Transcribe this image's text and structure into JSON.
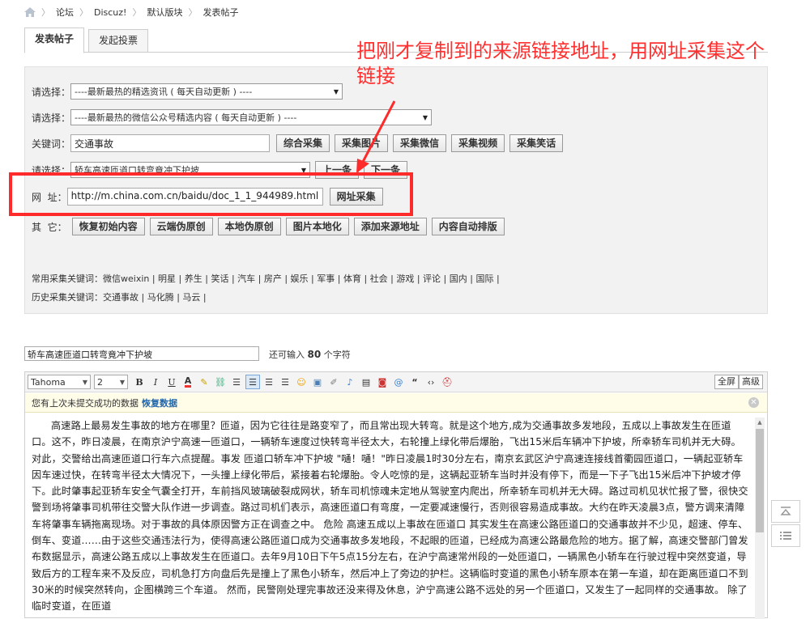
{
  "breadcrumb": [
    "论坛",
    "Discuz!",
    "默认版块",
    "发表帖子"
  ],
  "tabs": [
    "发表帖子",
    "发起投票"
  ],
  "panel": {
    "select1_label": "请选择：",
    "select1_value": "----最新最热的精选资讯 ( 每天自动更新 ) ----",
    "select2_label": "请选择：",
    "select2_value": "----最新最热的微信公众号精选内容 ( 每天自动更新 ) ----",
    "keyword_label": "关键词：",
    "keyword_value": "交通事故",
    "keyword_buttons": [
      "综合采集",
      "采集图片",
      "采集微信",
      "采集视频",
      "采集笑话"
    ],
    "select3_label": "请选择：",
    "select3_value": "轿车高速匝道口转弯竟冲下护坡",
    "prev_button": "上一条",
    "next_button": "下一条",
    "url_label": "网  址：",
    "url_value": "http://m.china.com.cn/baidu/doc_1_1_944989.html",
    "url_button": "网址采集",
    "other_label": "其  它：",
    "other_buttons": [
      "恢复初始内容",
      "云端伪原创",
      "本地伪原创",
      "图片本地化",
      "添加来源地址",
      "内容自动排版"
    ],
    "common_keywords": "常用采集关键词：微信weixin | 明星 | 养生 | 笑话 | 汽车 | 房产 | 娱乐 | 军事 | 体育 | 社会 | 游戏 | 评论 | 国内 | 国际 |",
    "history_keywords": "历史采集关键词：交通事故 | 马化腾 | 马云 |"
  },
  "annotation": {
    "text": "把刚才复制到的来源链接地址，用网址采集这个链接",
    "color": "#ff3030"
  },
  "post": {
    "title_value": "轿车高速匝道口转弯竟冲下护坡",
    "remaining_prefix": "还可输入",
    "remaining_count": "80",
    "remaining_suffix": "个字符"
  },
  "editor": {
    "font_family": "Tahoma",
    "font_size": "2",
    "toolbar_icons": [
      "bold-icon",
      "italic-icon",
      "underline-icon",
      "font-color-icon",
      "background-color-icon",
      "link-icon",
      "align-left-icon",
      "align-center-icon",
      "align-right-icon",
      "align-justify-icon",
      "emoticon-icon",
      "image-icon",
      "attachment-icon",
      "music-icon",
      "video-icon",
      "flash-icon",
      "mention-icon",
      "quote-icon",
      "code-icon",
      "free-icon"
    ],
    "fullscreen_label": "全屏",
    "advanced_label": "高级",
    "notice_text": "您有上次未提交成功的数据",
    "restore_label": "恢复数据",
    "article": "高速路上最易发生事故的地方在哪里？匝道，因为它往往是路变窄了，而且常出现大转弯。就是这个地方,成为交通事故多发地段，五成以上事故发生在匝道口。这不，昨日凌晨，在南京沪宁高速一匝道口，一辆轿车速度过快转弯半径太大，右轮撞上绿化带后爆胎，飞出15米后车辆冲下护坡，所幸轿车司机并无大碍。对此，交警给出高速匝道口行车六点提醒。事发 匝道口轿车冲下护坡 \"嗵！嗵！\"昨日凌晨1时30分左右，南京玄武区沪宁高速连接线首衢园匝道口，一辆起亚轿车因车速过快，在转弯半径太大情况下，一头撞上绿化带后，紧接着右轮爆胎。令人吃惊的是，这辆起亚轿车当时并没有停下，而是一下子飞出15米后冲下护坡才停下。此时肇事起亚轿车安全气囊全打开，车前挡风玻璃破裂成网状，轿车司机惊魂未定地从驾驶室内爬出，所幸轿车司机并无大碍。路过司机见状忙报了警，很快交警到场将肇事司机带往交警大队作进一步调查。路过司机们表示，高速匝道口有弯度，一定要减速慢行，否则很容易造成事故。大约在昨天凌晨3点，警方调来清障车将肇事车辆拖离现场。对于事故的具体原因警方正在调查之中。 危险 高速五成以上事故在匝道口 其实发生在高速公路匝道口的交通事故并不少见，超速、停车、倒车、变道……由于这些交通违法行为，使得高速公路匝道口成为交通事故多发地段，不起眼的匝道，已经成为高速公路最危险的地方。据了解，高速交警部门曾发布数据显示，高速公路五成以上事故发生在匝道口。去年9月10日下午5点15分左右，在沪宁高速常州段的一处匝道口，一辆黑色小轿车在行驶过程中突然变道，导致后方的工程车来不及反应，司机急打方向盘后先是撞上了黑色小轿车，然后冲上了旁边的护栏。这辆临时变道的黑色小轿车原本在第一车道，却在距离匝道口不到30米的时候突然转向，企图横跨三个车道。 然而，民警刚处理完事故还没来得及休息，沪宁高速公路不远处的另一个匝道口，又发生了一起同样的交通事故。 除了临时变道，在匝道"
  }
}
